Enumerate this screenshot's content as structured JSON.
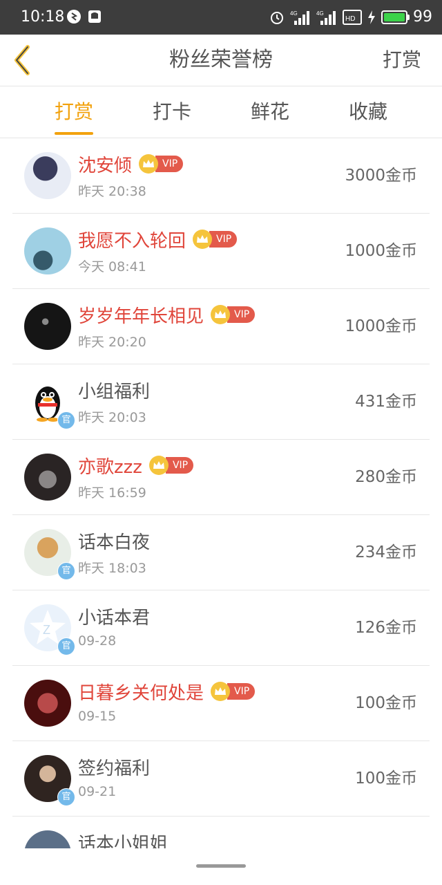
{
  "status_bar": {
    "time": "10:18",
    "network_labels": [
      "4G",
      "4G",
      "HD"
    ],
    "battery": "99",
    "battery_level": 0.99
  },
  "header": {
    "title": "粉丝荣誉榜",
    "action": "打赏"
  },
  "tabs": [
    {
      "label": "打赏",
      "active": true
    },
    {
      "label": "打卡",
      "active": false
    },
    {
      "label": "鲜花",
      "active": false
    },
    {
      "label": "收藏",
      "active": false
    }
  ],
  "vip_label": "VIP",
  "official_label": "官",
  "colors": {
    "accent": "#f2a20e",
    "vip_name": "#e0453a",
    "vip_pill": "#e35a4b",
    "official_badge": "#73b9ea"
  },
  "list": [
    {
      "name": "沈安倾",
      "time": "昨天 20:38",
      "amount": "3000金币",
      "vip": true,
      "official": false
    },
    {
      "name": "我愿不入轮回",
      "time": "今天 08:41",
      "amount": "1000金币",
      "vip": true,
      "official": false
    },
    {
      "name": "岁岁年年长相见",
      "time": "昨天 20:20",
      "amount": "1000金币",
      "vip": true,
      "official": false
    },
    {
      "name": "小组福利",
      "time": "昨天 20:03",
      "amount": "431金币",
      "vip": false,
      "official": true
    },
    {
      "name": "亦歌zzz",
      "time": "昨天 16:59",
      "amount": "280金币",
      "vip": true,
      "official": false
    },
    {
      "name": "话本白夜",
      "time": "昨天 18:03",
      "amount": "234金币",
      "vip": false,
      "official": true
    },
    {
      "name": "小话本君",
      "time": "09-28",
      "amount": "126金币",
      "vip": false,
      "official": true
    },
    {
      "name": "日暮乡关何处是",
      "time": "09-15",
      "amount": "100金币",
      "vip": true,
      "official": false
    },
    {
      "name": "签约福利",
      "time": "09-21",
      "amount": "100金币",
      "vip": false,
      "official": true
    },
    {
      "name": "话本小姐姐",
      "time": "",
      "amount": "",
      "vip": false,
      "official": false
    }
  ]
}
